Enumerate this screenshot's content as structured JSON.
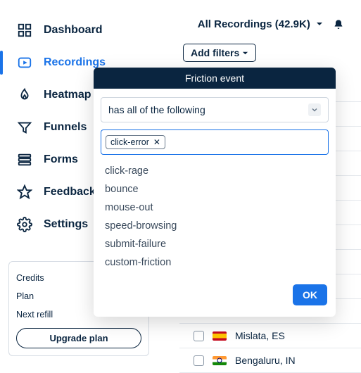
{
  "header": {
    "recordings_label": "All Recordings (42.9K)",
    "add_filters_label": "Add filters",
    "bell_icon": "bell"
  },
  "sidebar": {
    "items": [
      {
        "label": "Dashboard",
        "icon": "grid"
      },
      {
        "label": "Recordings",
        "icon": "play",
        "active": true
      },
      {
        "label": "Heatmap",
        "icon": "flame"
      },
      {
        "label": "Funnels",
        "icon": "funnel"
      },
      {
        "label": "Forms",
        "icon": "forms"
      },
      {
        "label": "Feedback",
        "icon": "star"
      },
      {
        "label": "Settings",
        "icon": "gear"
      }
    ]
  },
  "plan": {
    "credits_label": "Credits",
    "plan_label": "Plan",
    "refill_label": "Next refill",
    "upgrade_label": "Upgrade plan"
  },
  "filter_panel": {
    "title": "Friction event",
    "condition_label": "has all of the following",
    "selected_tags": [
      "click-error"
    ],
    "options": [
      "click-rage",
      "bounce",
      "mouse-out",
      "speed-browsing",
      "submit-failure",
      "custom-friction"
    ],
    "ok_label": "OK"
  },
  "list": {
    "rows": [
      {
        "city": "",
        "flag": ""
      },
      {
        "city": "",
        "flag": ""
      },
      {
        "city": "",
        "flag": ""
      },
      {
        "city": "",
        "flag": ""
      },
      {
        "city": "",
        "flag": ""
      },
      {
        "city": "",
        "flag": ""
      },
      {
        "city": "",
        "flag": ""
      },
      {
        "city": "",
        "flag": ""
      },
      {
        "city": "",
        "flag": ""
      },
      {
        "city": "",
        "flag": ""
      },
      {
        "city": "Mislata, ES",
        "flag": "es"
      },
      {
        "city": "Bengaluru, IN",
        "flag": "in"
      }
    ]
  }
}
